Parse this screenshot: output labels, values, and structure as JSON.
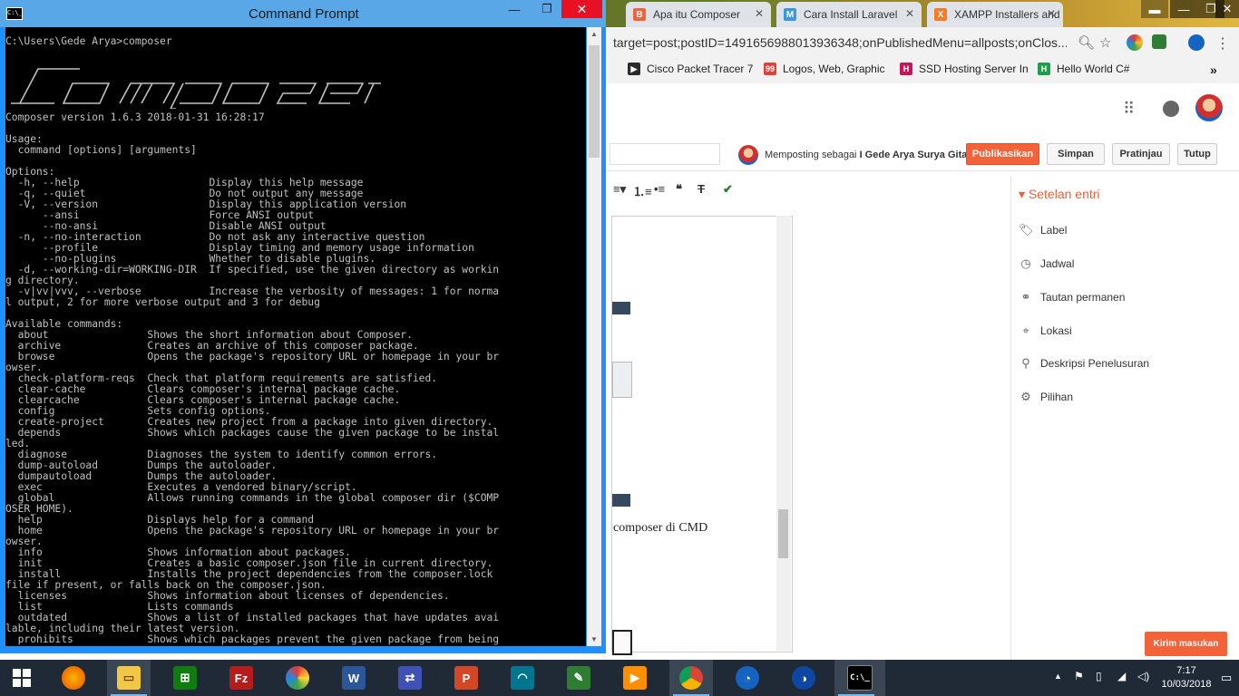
{
  "cmd": {
    "title": "Command Prompt",
    "console_text": "C:\\Users\\Gede Arya>composer\n\n\n\n\n\n\nComposer version 1.6.3 2018-01-31 16:28:17\n\nUsage:\n  command [options] [arguments]\n\nOptions:\n  -h, --help                     Display this help message\n  -q, --quiet                    Do not output any message\n  -V, --version                  Display this application version\n      --ansi                     Force ANSI output\n      --no-ansi                  Disable ANSI output\n  -n, --no-interaction           Do not ask any interactive question\n      --profile                  Display timing and memory usage information\n      --no-plugins               Whether to disable plugins.\n  -d, --working-dir=WORKING-DIR  If specified, use the given directory as workin\ng directory.\n  -v|vv|vvv, --verbose           Increase the verbosity of messages: 1 for norma\nl output, 2 for more verbose output and 3 for debug\n\nAvailable commands:\n  about                Shows the short information about Composer.\n  archive              Creates an archive of this composer package.\n  browse               Opens the package's repository URL or homepage in your br\nowser.\n  check-platform-reqs  Check that platform requirements are satisfied.\n  clear-cache          Clears composer's internal package cache.\n  clearcache           Clears composer's internal package cache.\n  config               Sets config options.\n  create-project       Creates new project from a package into given directory.\n  depends              Shows which packages cause the given package to be instal\nled.\n  diagnose             Diagnoses the system to identify common errors.\n  dump-autoload        Dumps the autoloader.\n  dumpautoload         Dumps the autoloader.\n  exec                 Executes a vendored binary/script.\n  global               Allows running commands in the global composer dir ($COMP\nOSER_HOME).\n  help                 Displays help for a command\n  home                 Opens the package's repository URL or homepage in your br\nowser.\n  info                 Shows information about packages.\n  init                 Creates a basic composer.json file in current directory.\n  install              Installs the project dependencies from the composer.lock\nfile if present, or falls back on the composer.json.\n  licenses             Shows information about licenses of dependencies.\n  list                 Lists commands\n  outdated             Shows a list of installed packages that have updates avai\nlable, including their latest version.\n  prohibits            Shows which packages prevent the given package from being"
  },
  "browser": {
    "tabs": [
      {
        "label": "Apa itu Composer",
        "icon": "blogger-icon",
        "color": "#f4623a"
      },
      {
        "label": "Cara Install Laravel",
        "icon": "medium-icon",
        "color": "#3a9ad9"
      },
      {
        "label": "XAMPP Installers and Downloads",
        "icon": "xampp-icon",
        "color": "#fb7a24"
      }
    ],
    "url": "target=post;postID=1491656988013936348;onPublishedMenu=allposts;onClos...",
    "bookmarks": [
      {
        "label": "Cisco Packet Tracer 7",
        "icon": "cisco-icon",
        "color": "#2b2b2b"
      },
      {
        "label": "Logos, Web, Graphic",
        "icon": "99designs-icon",
        "color": "#e0433a"
      },
      {
        "label": "SSD Hosting Server In",
        "icon": "hosting-icon",
        "color": "#c2185b"
      },
      {
        "label": "Hello World C#",
        "icon": "hello-icon",
        "color": "#1e9e4a"
      }
    ]
  },
  "blogger": {
    "posting_as_prefix": "Memposting sebagai ",
    "posting_as_name": "I Gede Arya Surya Gita",
    "publish_label": "Publikasikan",
    "save_label": "Simpan",
    "preview_label": "Pratinjau",
    "close_label": "Tutup",
    "editor_text_fragment": "composer di CMD",
    "sidebar": {
      "heading": "Setelan entri",
      "items": [
        {
          "label": "Label",
          "icon": "tag-icon"
        },
        {
          "label": "Jadwal",
          "icon": "clock-icon"
        },
        {
          "label": "Tautan permanen",
          "icon": "link-icon"
        },
        {
          "label": "Lokasi",
          "icon": "location-icon"
        },
        {
          "label": "Deskripsi Penelusuran",
          "icon": "search-icon"
        },
        {
          "label": "Pilihan",
          "icon": "gear-icon"
        }
      ]
    },
    "feedback_label": "Kirim masukan"
  },
  "taskbar": {
    "time": "7:17",
    "date": "10/03/2018"
  },
  "colors": {
    "accent": "#f4623a",
    "taskbar": "#1f2a36",
    "cmd_border": "#1e90ff"
  }
}
